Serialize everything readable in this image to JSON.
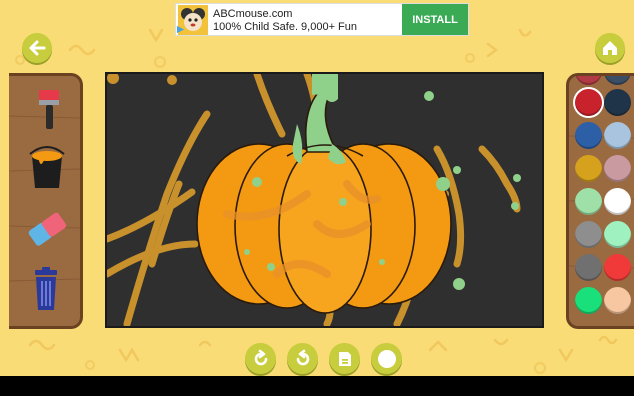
{
  "ad": {
    "title": "ABCmouse.com",
    "subtitle": "100% Child Safe. 9,000+ Fun",
    "install_label": "INSTALL"
  },
  "nav": {
    "back_icon": "arrow-left-icon",
    "home_icon": "home-icon"
  },
  "tools": [
    {
      "name": "paint-brush",
      "icon": "paint-brush-icon"
    },
    {
      "name": "paint-bucket",
      "icon": "paint-bucket-icon"
    },
    {
      "name": "eraser",
      "icon": "eraser-icon"
    },
    {
      "name": "trash",
      "icon": "trash-icon"
    }
  ],
  "palette": {
    "colors": [
      "#c8232c",
      "#1f3448",
      "#2d5fa6",
      "#a8c4df",
      "#d6a21e",
      "#c99aa0",
      "#9fe0a8",
      "#ffffff",
      "#8e8e8e",
      "#9ff2c0",
      "#707070",
      "#f03a3a",
      "#19e07a",
      "#f6c7a0"
    ],
    "top_partial": [
      "#b23a44",
      "#3a4f66"
    ]
  },
  "bottom_controls": [
    {
      "name": "undo",
      "icon": "undo-icon"
    },
    {
      "name": "redo",
      "icon": "redo-icon"
    },
    {
      "name": "save",
      "icon": "save-icon"
    },
    {
      "name": "brush-size",
      "icon": "circle-icon"
    }
  ],
  "drawing": {
    "subject": "pumpkin",
    "background": "#2f2f2f",
    "pumpkin_color": "#f39a12",
    "stem_color": "#8fd18b",
    "stroke_color": "#c8912c"
  }
}
